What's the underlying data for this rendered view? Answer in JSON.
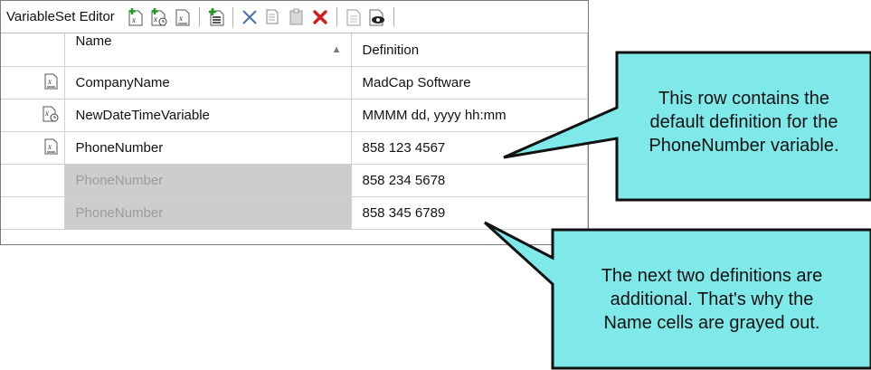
{
  "editor": {
    "title": "VariableSet Editor",
    "toolbar_icons": [
      "add-variable-icon",
      "add-datetime-variable-icon",
      "edit-variable-icon",
      "add-definition-icon",
      "cut-icon",
      "copy-icon",
      "paste-icon",
      "delete-icon",
      "properties-icon",
      "preview-icon"
    ]
  },
  "table": {
    "columns": {
      "name": "Name",
      "definition": "Definition"
    },
    "rows": [
      {
        "icon": "variable-icon",
        "name": "CompanyName",
        "definition": "MadCap Software",
        "grayed": false
      },
      {
        "icon": "datetime-variable-icon",
        "name": "NewDateTimeVariable",
        "definition": "MMMM dd, yyyy hh:mm",
        "grayed": false
      },
      {
        "icon": "variable-icon",
        "name": "PhoneNumber",
        "definition": "858 123 4567",
        "grayed": false
      },
      {
        "icon": "",
        "name": "PhoneNumber",
        "definition": "858 234 5678",
        "grayed": true
      },
      {
        "icon": "",
        "name": "PhoneNumber",
        "definition": "858 345 6789",
        "grayed": true
      }
    ]
  },
  "callouts": {
    "top": [
      "This row contains the",
      "default definition for the",
      "PhoneNumber variable."
    ],
    "bottom": [
      "The next two definitions are",
      "additional. That's why the",
      "Name cells are grayed out."
    ],
    "fill_color": "#7fe9e9",
    "border_color": "#111111"
  }
}
